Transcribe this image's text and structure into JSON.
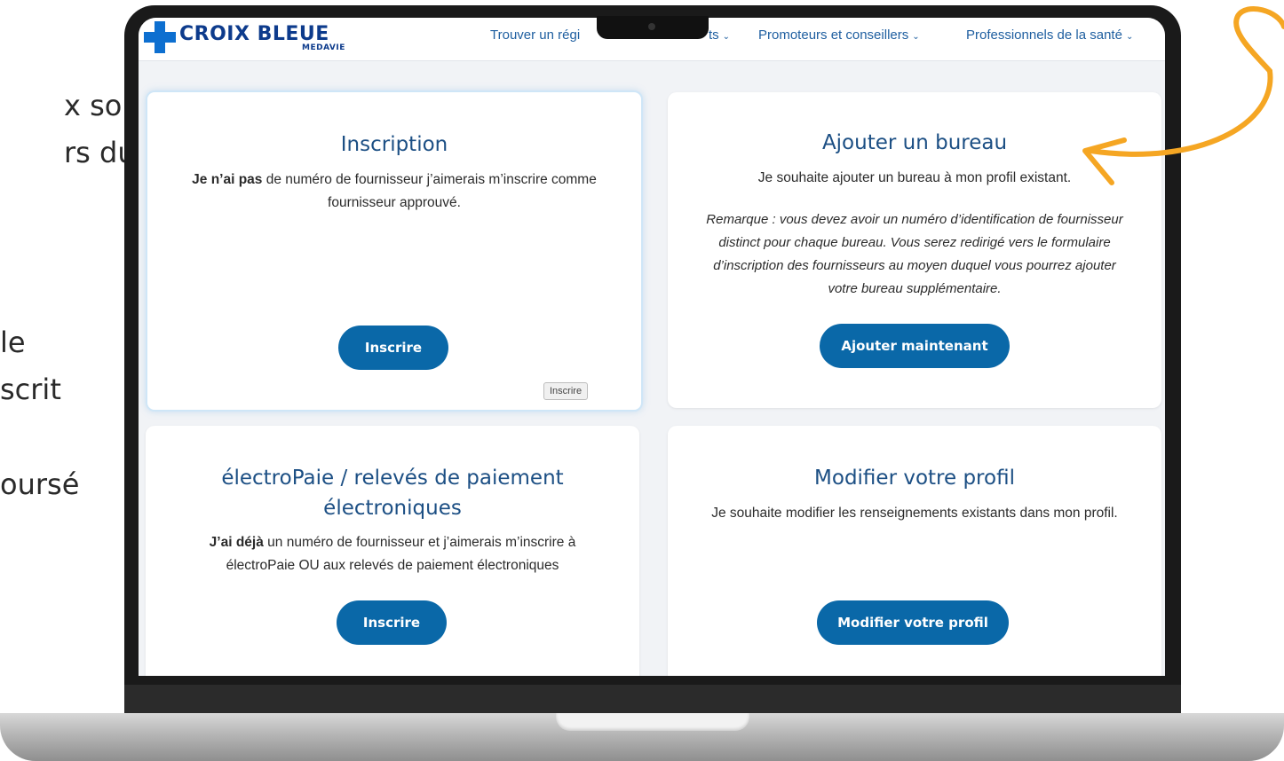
{
  "side_texts": [
    "x sont",
    "rs du",
    "le",
    "scrit",
    "oursé"
  ],
  "site": {
    "logo_main": "CROIX BLEUE",
    "logo_sub": "MEDAVIE",
    "nav": [
      {
        "label": "Trouver un régi"
      },
      {
        "label": "ts"
      },
      {
        "label": "Promoteurs et conseillers"
      },
      {
        "label": "Professionnels de la santé"
      }
    ]
  },
  "cards": {
    "inscription": {
      "title": "Inscription",
      "desc_bold": "Je n’ai pas",
      "desc_rest": " de numéro de fournisseur j’aimerais m’inscrire comme fournisseur approuvé.",
      "button": "Inscrire",
      "tooltip": "Inscrire"
    },
    "ajouter": {
      "title": "Ajouter un bureau",
      "desc": "Je souhaite ajouter un bureau à mon profil existant.",
      "note": "Remarque : vous devez avoir un numéro d’identification de fournisseur distinct pour chaque bureau. Vous serez redirigé vers le formulaire d’inscription des fournisseurs au moyen duquel vous pourrez ajouter votre bureau supplémentaire.",
      "button": "Ajouter maintenant"
    },
    "electropaie": {
      "title": "électroPaie / relevés de paiement électroniques",
      "desc_bold": "J’ai déjà",
      "desc_rest": " un numéro de fournisseur et j’aimerais m’inscrire à électroPaie OU aux relevés de paiement électroniques",
      "button": "Inscrire"
    },
    "modifier": {
      "title": "Modifier votre profil",
      "desc": "Je souhaite modifier les renseignements existants dans mon profil.",
      "button": "Modifier votre profil"
    }
  },
  "colors": {
    "brand_blue": "#0d3b8c",
    "link_blue": "#1f5fa0",
    "button_blue": "#0a68a8",
    "annotation_orange": "#f5a623"
  },
  "icons": [
    "cross-logo-icon",
    "chevron-down-icon",
    "curved-arrow-annotation-icon"
  ]
}
